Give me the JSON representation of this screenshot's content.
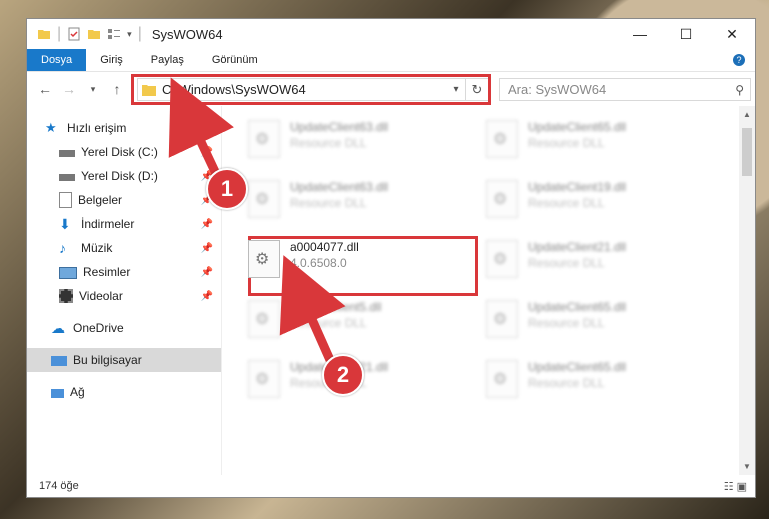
{
  "window": {
    "title": "SysWOW64"
  },
  "controls": {
    "minimize": "—",
    "maximize": "☐",
    "close": "✕"
  },
  "ribbon": {
    "tabs": [
      "Dosya",
      "Giriş",
      "Paylaş",
      "Görünüm"
    ]
  },
  "address": {
    "path": "C:\\Windows\\SysWOW64"
  },
  "search": {
    "placeholder": "Ara: SysWOW64"
  },
  "nav": {
    "items": [
      {
        "label": "Hızlı erişim",
        "icon": "star-icon",
        "pinned": false
      },
      {
        "label": "Yerel Disk (C:)",
        "icon": "drive-icon",
        "pinned": true
      },
      {
        "label": "Yerel Disk (D:)",
        "icon": "drive-icon",
        "pinned": true
      },
      {
        "label": "Belgeler",
        "icon": "documents-icon",
        "pinned": true
      },
      {
        "label": "İndirmeler",
        "icon": "download-icon",
        "pinned": true
      },
      {
        "label": "Müzik",
        "icon": "music-icon",
        "pinned": true
      },
      {
        "label": "Resimler",
        "icon": "pictures-icon",
        "pinned": true
      },
      {
        "label": "Videolar",
        "icon": "video-icon",
        "pinned": true
      },
      {
        "label": "OneDrive",
        "icon": "cloud-icon",
        "pinned": false
      },
      {
        "label": "Bu bilgisayar",
        "icon": "computer-icon",
        "pinned": false
      },
      {
        "label": "Ağ",
        "icon": "network-icon",
        "pinned": false
      }
    ]
  },
  "files": [
    {
      "name": "UpdateClient63.dll",
      "sub": "Resource DLL",
      "col": 0,
      "row": 0
    },
    {
      "name": "UpdateClient65.dll",
      "sub": "Resource DLL",
      "col": 1,
      "row": 0
    },
    {
      "name": "UpdateClient63.dll",
      "sub": "Resource DLL",
      "col": 0,
      "row": 1
    },
    {
      "name": "UpdateClient19.dll",
      "sub": "Resource DLL",
      "col": 1,
      "row": 1
    },
    {
      "name": "a0004077.dll",
      "sub": "4.0.6508.0",
      "col": 0,
      "row": 2,
      "clear": true
    },
    {
      "name": "UpdateClient21.dll",
      "sub": "Resource DLL",
      "col": 1,
      "row": 2
    },
    {
      "name": "UpdateClient5.dll",
      "sub": "Resource DLL",
      "col": 0,
      "row": 3
    },
    {
      "name": "UpdateClient65.dll",
      "sub": "Resource DLL",
      "col": 1,
      "row": 3
    },
    {
      "name": "UpdateClient21.dll",
      "sub": "Resource DLL",
      "col": 0,
      "row": 4
    },
    {
      "name": "UpdateClient65.dll",
      "sub": "Resource DLL",
      "col": 1,
      "row": 4
    }
  ],
  "status": {
    "count": "174 öğe"
  },
  "callouts": [
    "1",
    "2"
  ],
  "colors": {
    "accent": "#1979ca",
    "highlight": "#d9373a"
  }
}
